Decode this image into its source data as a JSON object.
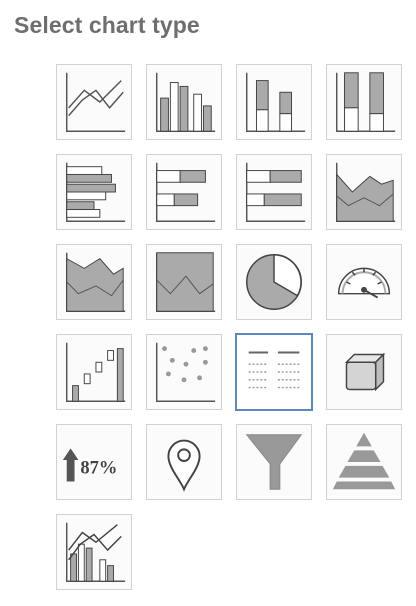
{
  "title": "Select chart type",
  "accent_color": "#5a8ac6",
  "selected": "table",
  "tiles": [
    {
      "name": "line-chart-icon"
    },
    {
      "name": "column-chart-icon"
    },
    {
      "name": "stacked-column-chart-icon"
    },
    {
      "name": "percent-stacked-column-chart-icon"
    },
    {
      "name": "bar-chart-icon"
    },
    {
      "name": "stacked-bar-chart-icon"
    },
    {
      "name": "percent-stacked-bar-chart-icon"
    },
    {
      "name": "area-chart-icon"
    },
    {
      "name": "stacked-area-chart-icon"
    },
    {
      "name": "percent-stacked-area-chart-icon"
    },
    {
      "name": "pie-chart-icon"
    },
    {
      "name": "gauge-chart-icon"
    },
    {
      "name": "waterfall-chart-icon"
    },
    {
      "name": "scatter-chart-icon"
    },
    {
      "name": "table-icon"
    },
    {
      "name": "3d-cube-icon"
    },
    {
      "name": "kpi-icon",
      "text": "87%"
    },
    {
      "name": "map-pin-icon"
    },
    {
      "name": "funnel-chart-icon"
    },
    {
      "name": "pyramid-chart-icon"
    },
    {
      "name": "combo-chart-icon"
    }
  ]
}
